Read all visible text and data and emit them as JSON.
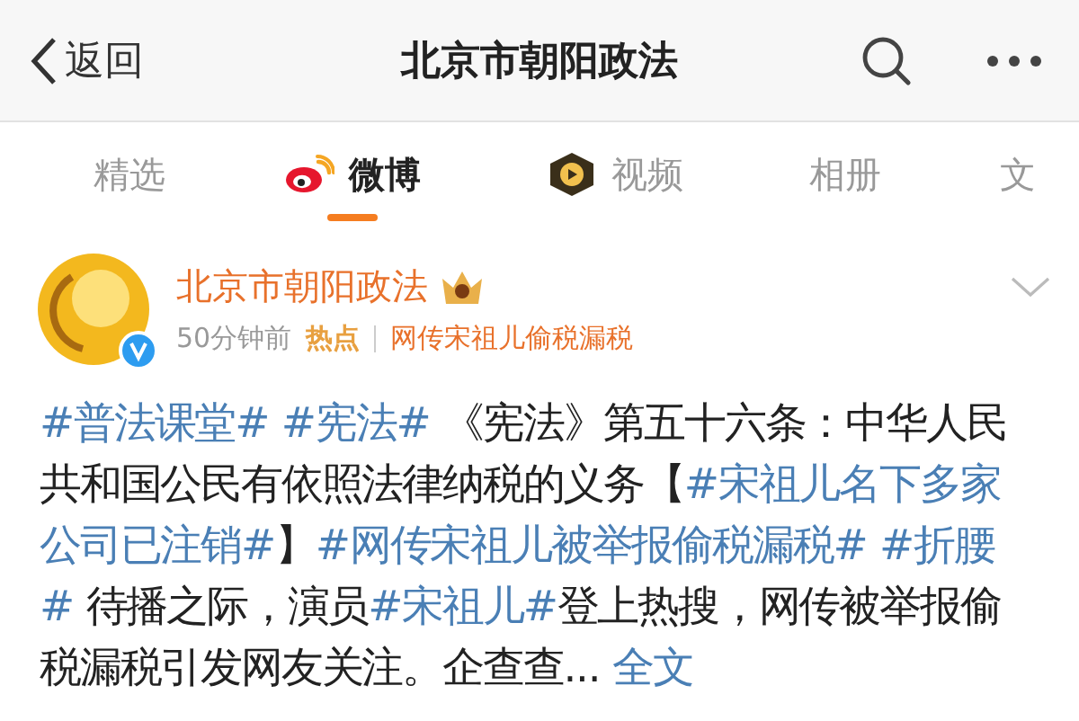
{
  "header": {
    "back_label": "返回",
    "title": "北京市朝阳政法"
  },
  "tabs": [
    {
      "label": "精选",
      "selected": false,
      "kind": "text"
    },
    {
      "label": "微博",
      "selected": true,
      "kind": "logo"
    },
    {
      "label": "视频",
      "selected": false,
      "kind": "badge"
    },
    {
      "label": "相册",
      "selected": false,
      "kind": "text"
    },
    {
      "label": "文",
      "selected": false,
      "kind": "text"
    }
  ],
  "post": {
    "author": "北京市朝阳政法",
    "verified": true,
    "time": "50分钟前",
    "hot_label": "热点",
    "hot_topic": "网传宋祖儿偷税漏税",
    "segments": [
      {
        "kind": "topic",
        "text": "#普法课堂# #宪法#"
      },
      {
        "kind": "text",
        "text": " 《宪法》第五十六条：中华人民共和国公民有依照法律纳税的义务【"
      },
      {
        "kind": "topic",
        "text": "#宋祖儿名下多家公司已注销#"
      },
      {
        "kind": "text",
        "text": "】"
      },
      {
        "kind": "topic",
        "text": "#网传宋祖儿被举报偷税漏税# #折腰#"
      },
      {
        "kind": "text",
        "text": " 待播之际，演员"
      },
      {
        "kind": "topic",
        "text": "#宋祖儿#"
      },
      {
        "kind": "text",
        "text": "登上热搜，网传被举报偷税漏税引发网友关注。企查查..."
      }
    ],
    "more_link": "全文"
  }
}
